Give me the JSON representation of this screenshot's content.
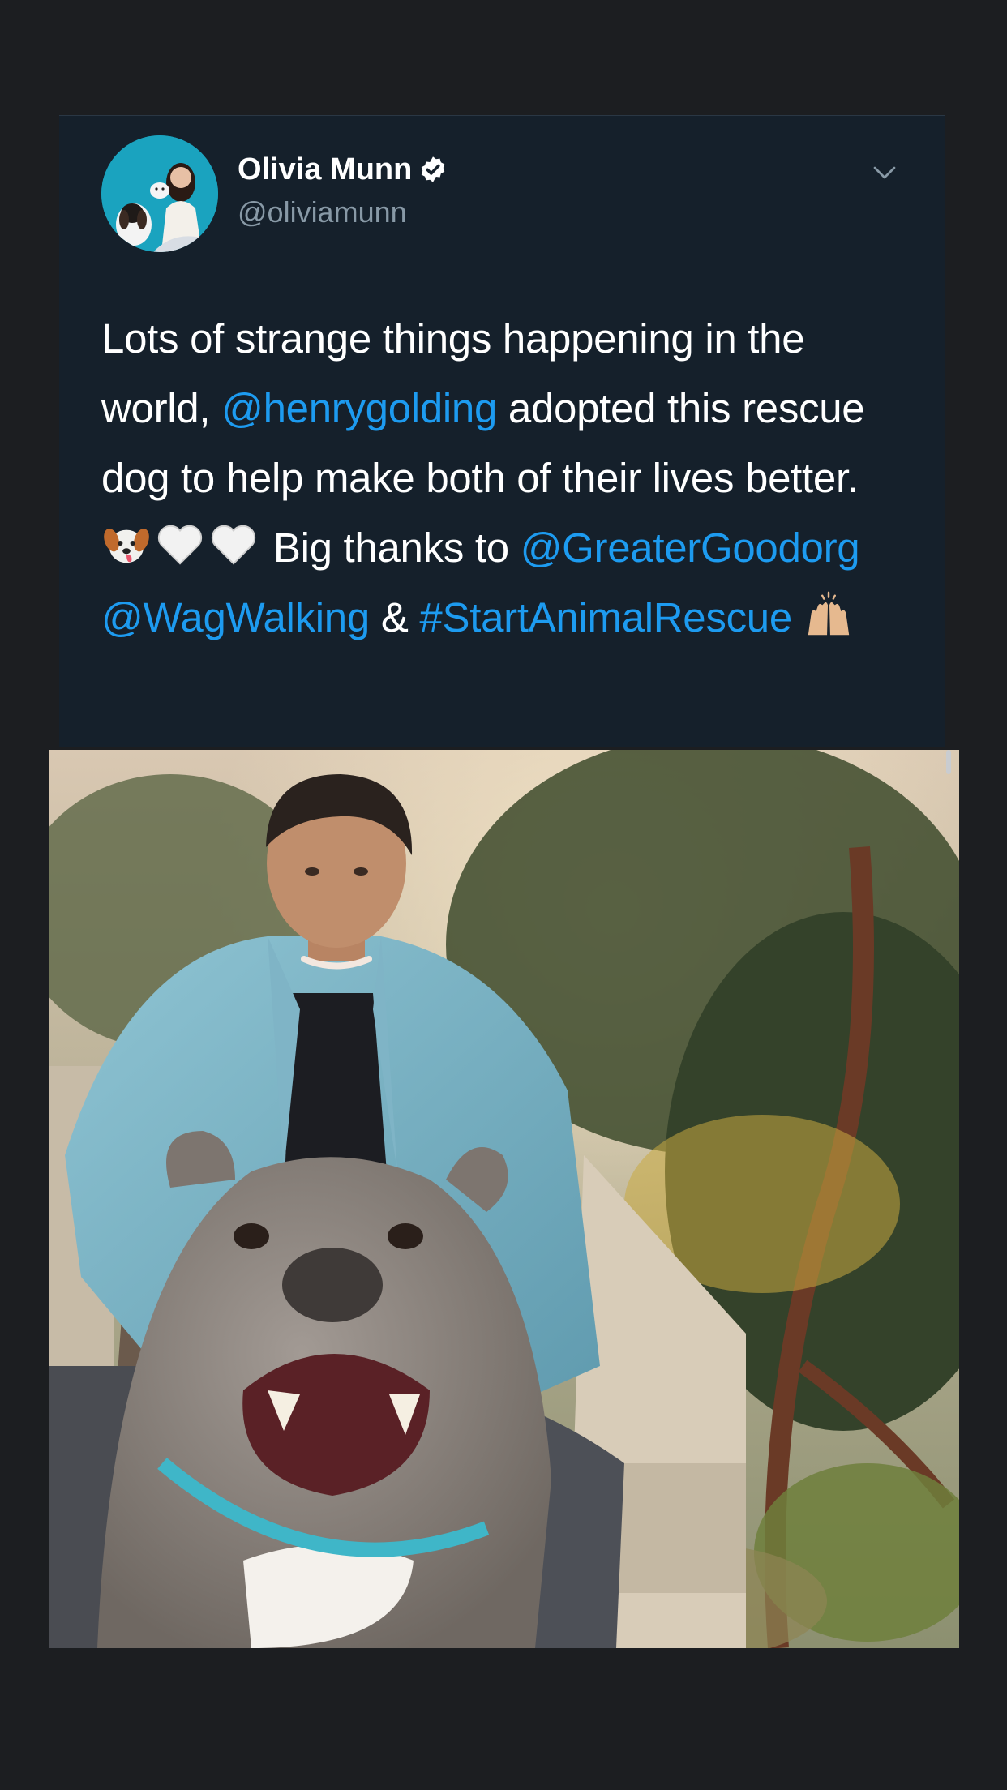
{
  "tweet": {
    "author": {
      "display_name": "Olivia Munn",
      "handle": "@oliviamunn",
      "verified": true
    },
    "text_segments": [
      {
        "text": "Lots of strange things happening in the world, ",
        "type": "text"
      },
      {
        "text": "@henrygolding",
        "type": "mention"
      },
      {
        "text": " adopted this rescue dog to help make both of their lives better. ",
        "type": "text"
      },
      {
        "text": "Big thanks to ",
        "type": "text"
      },
      {
        "text": "@GreaterGoodorg",
        "type": "mention"
      },
      {
        "text": "@WagWalking",
        "type": "mention"
      },
      {
        "text": "&",
        "type": "text"
      },
      {
        "text": "#StartAnimalRescue",
        "type": "hashtag"
      }
    ],
    "emojis": [
      "dog-face-emoji",
      "white-heart-emoji",
      "white-heart-emoji",
      "raising-hands-emoji"
    ],
    "media": {
      "type": "photo"
    }
  },
  "colors": {
    "background": "#1c1e21",
    "card": "#15202b",
    "link": "#1d9bf0",
    "secondary_text": "#8899a6"
  }
}
